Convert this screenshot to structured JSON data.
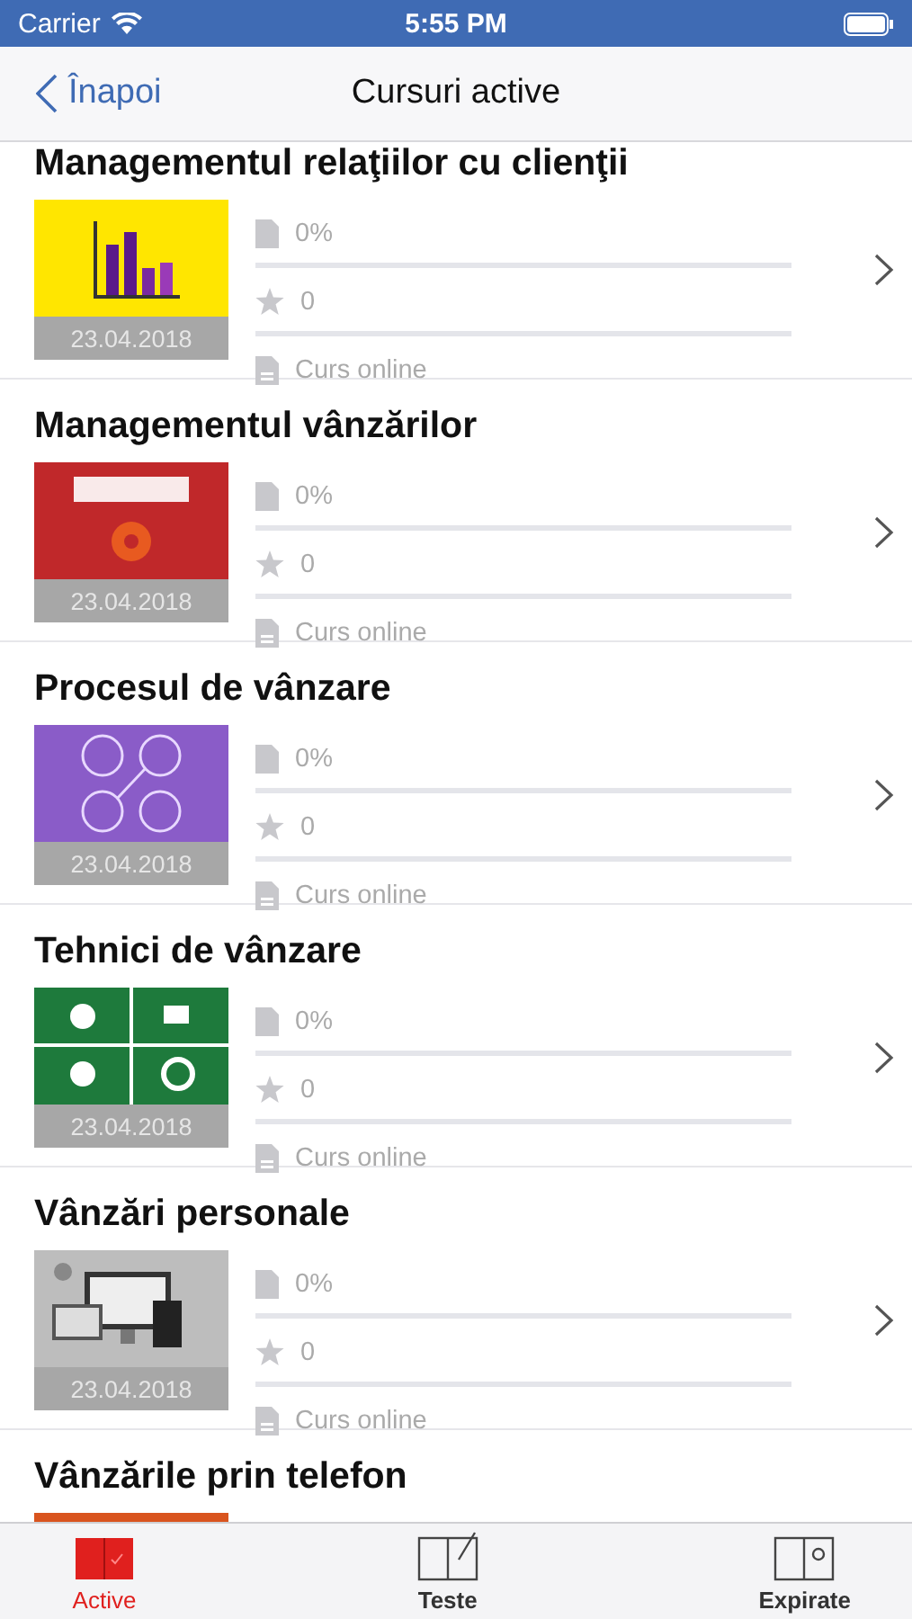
{
  "status_bar": {
    "carrier": "Carrier",
    "time": "5:55 PM"
  },
  "nav": {
    "back": "Înapoi",
    "title": "Cursuri active"
  },
  "courses": [
    {
      "kind": "full",
      "title": "Managementul relaţiilor cu clienţii",
      "color": "#ffe600",
      "date": "23.04.2018",
      "progress": "0%",
      "rating": "0",
      "type": "Curs online"
    },
    {
      "kind": "full",
      "title": "Managementul vânzărilor",
      "color": "#c0282a",
      "date": "23.04.2018",
      "progress": "0%",
      "rating": "0",
      "type": "Curs online"
    },
    {
      "kind": "full",
      "title": "Procesul de vânzare",
      "color": "#8a5cc8",
      "date": "23.04.2018",
      "progress": "0%",
      "rating": "0",
      "type": "Curs online"
    },
    {
      "kind": "full",
      "title": "Tehnici de vânzare",
      "color": "#1e7a3c",
      "date": "23.04.2018",
      "progress": "0%",
      "rating": "0",
      "type": "Curs online"
    },
    {
      "kind": "full",
      "title": "Vânzări personale",
      "color": "#bdbdbd",
      "date": "23.04.2018",
      "progress": "0%",
      "rating": "0",
      "type": "Curs online"
    },
    {
      "kind": "partial",
      "title": "Vânzările prin telefon",
      "color": "#d9541e"
    }
  ],
  "tabs": [
    {
      "label": "Active",
      "selected": true
    },
    {
      "label": "Teste",
      "selected": false
    },
    {
      "label": "Expirate",
      "selected": false
    }
  ]
}
